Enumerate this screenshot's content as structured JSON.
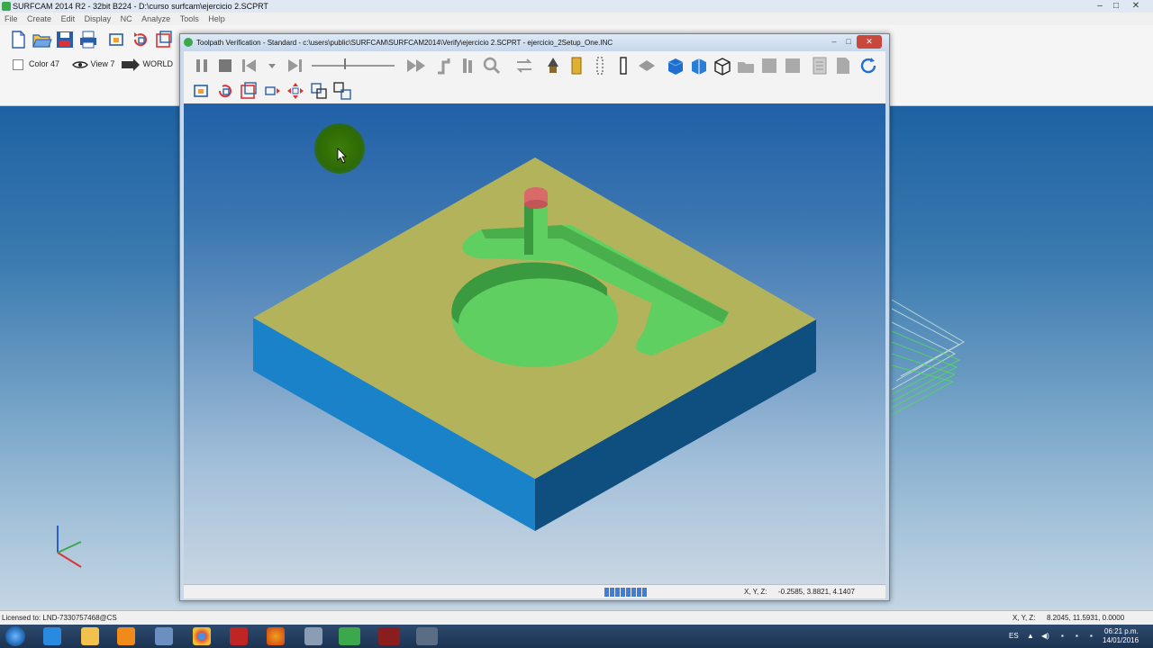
{
  "app": {
    "title": "SURFCAM 2014 R2 - 32bit B224 - D:\\curso surfcam\\ejercicio 2.SCPRT",
    "menu": [
      "File",
      "Create",
      "Edit",
      "Display",
      "NC",
      "Analyze",
      "Tools",
      "Help"
    ]
  },
  "toolbar": {
    "color_label": "Color 47",
    "view_label": "View 7",
    "cplane_label": "WORLD"
  },
  "dialog": {
    "title": "Toolpath Verification - Standard - c:\\users\\public\\SURFCAM\\SURFCAM2014\\Verify\\ejercicio 2.SCPRT - ejercicio_2Setup_One.INC",
    "xyz_label": "X, Y, Z:",
    "xyz_value": "-0.2585, 3.8821, 4.1407",
    "progress_segments": 8,
    "part_colors": {
      "top": "#b3b35c",
      "side_left": "#1a82c8",
      "side_right": "#0f4f80",
      "pocket": "#5fcf61",
      "tool": "#d86a6a"
    }
  },
  "status": {
    "license": "Licensed to: LND-7330757468@CS",
    "xyz_label": "X, Y, Z:",
    "xyz_value": "8.2045, 11.5931, 0.0000"
  },
  "taskbar": {
    "lang": "ES",
    "time": "06:21 p.m.",
    "date": "14/01/2016"
  }
}
